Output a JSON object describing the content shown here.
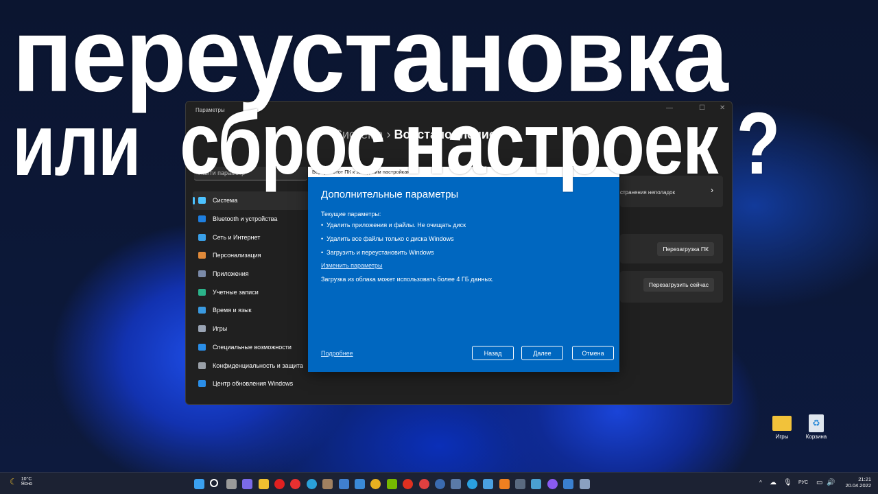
{
  "overlay": {
    "line1": "переустановка",
    "line2a": "или",
    "line2b": "сброс настроек ?"
  },
  "settings": {
    "title": "Параметры",
    "search_placeholder": "Найти параметр",
    "breadcrumb": {
      "parent": "Система",
      "sep": "›",
      "current": "Восстановление"
    },
    "nav": [
      {
        "label": "Система",
        "color": "#4cc2ff",
        "selected": true
      },
      {
        "label": "Bluetooth и устройства",
        "color": "#1e7fe0"
      },
      {
        "label": "Сеть и Интернет",
        "color": "#3aa0e8"
      },
      {
        "label": "Персонализация",
        "color": "#e08a3a"
      },
      {
        "label": "Приложения",
        "color": "#7a8aa8"
      },
      {
        "label": "Учетные записи",
        "color": "#2bb38a"
      },
      {
        "label": "Время и язык",
        "color": "#3a9ae0"
      },
      {
        "label": "Игры",
        "color": "#9aa4b4"
      },
      {
        "label": "Специальные возможности",
        "color": "#2a8ee8"
      },
      {
        "label": "Конфиденциальность и защита",
        "color": "#9aa0a8"
      },
      {
        "label": "Центр обновления Windows",
        "color": "#2a8ee8"
      }
    ],
    "troubleshoot_text": "странения неполадок",
    "restart_pc_button": "Перезагрузка ПК",
    "restart_now_button": "Перезагрузить сейчас"
  },
  "dialog": {
    "window_title": "Вернуть этот ПК к заводским настройкам",
    "heading": "Дополнительные параметры",
    "current_label": "Текущие параметры:",
    "bullets": [
      "Удалить приложения и файлы. Не очищать диск",
      "Удалить все файлы только с диска Windows",
      "Загрузить и переустановить Windows"
    ],
    "change_link": "Изменить параметры",
    "note": "Загрузка из облака может использовать более 4 ГБ данных.",
    "more_link": "Подробнее",
    "back": "Назад",
    "next": "Далее",
    "cancel": "Отмена",
    "accent": "#0067c0"
  },
  "desktop": {
    "icons": [
      {
        "label": "Игры"
      },
      {
        "label": "Корзина"
      }
    ]
  },
  "taskbar": {
    "weather": {
      "temp": "10°C",
      "cond": "Ясно"
    },
    "apps": [
      "start",
      "search",
      "task-view",
      "chat",
      "explorer",
      "opera",
      "yandex-browser",
      "edge",
      "app",
      "paint",
      "store",
      "chrome",
      "nvidia",
      "yandex",
      "ea",
      "steam",
      "calculator",
      "telegram",
      "notepad",
      "vlc",
      "camera",
      "monitor",
      "alice",
      "photos",
      "settings"
    ],
    "app_colors": [
      "#3aa0f0",
      "#ffffff",
      "#9a9a9a",
      "#7a6ae8",
      "#f0c030",
      "#e02020",
      "#e83030",
      "#2aa0d8",
      "#a08060",
      "#4080d0",
      "#3a8ad8",
      "#e8b020",
      "#76b900",
      "#e03020",
      "#e04040",
      "#3a6ab0",
      "#5a7aa8",
      "#2aa0e0",
      "#4aa0e0",
      "#f08020",
      "#5a6a80",
      "#4aa0d0",
      "#8a5af0",
      "#3a80d0",
      "#8aa0c0"
    ],
    "lang": "РУС",
    "time": "21:21",
    "date": "20.04.2022"
  }
}
